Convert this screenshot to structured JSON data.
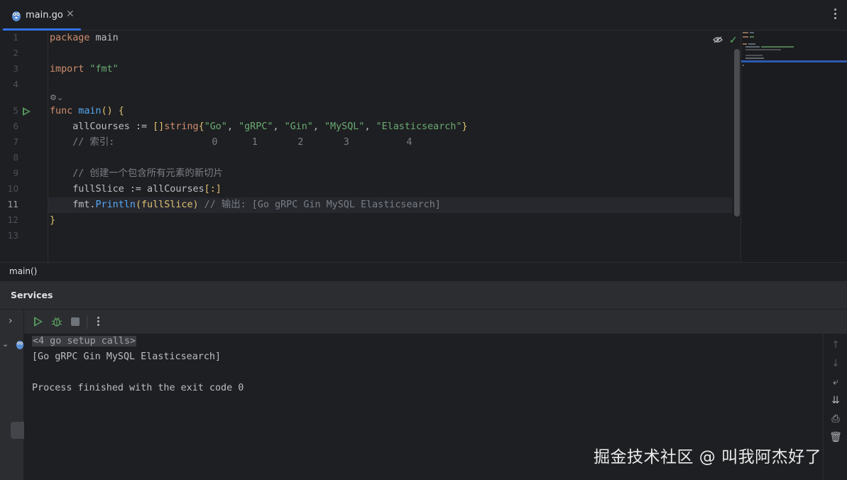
{
  "tab": {
    "file_name": "main.go",
    "close_glyph": "✕",
    "icon": "gopher-icon"
  },
  "editor": {
    "line_numbers": [
      "1",
      "2",
      "3",
      "4",
      "5",
      "6",
      "7",
      "8",
      "9",
      "10",
      "11",
      "12",
      "13"
    ],
    "current_line": "11",
    "lines": {
      "l1_kw": "package",
      "l1_name": " main",
      "l3_kw": "import",
      "l3_str": " \"fmt\"",
      "l5_kw": "func",
      "l5_fn": " main",
      "l5_rest": "() {",
      "l6_var": "    allCourses := ",
      "l6_br": "[]",
      "l6_type": "string",
      "l6_open": "{",
      "l6_s1": "\"Go\"",
      "l6_c1": ", ",
      "l6_s2": "\"gRPC\"",
      "l6_c2": ", ",
      "l6_s3": "\"Gin\"",
      "l6_c3": ", ",
      "l6_s4": "\"MySQL\"",
      "l6_c4": ", ",
      "l6_s5": "\"Elasticsearch\"",
      "l6_close": "}",
      "l7_cmt": "    // 索引:                 0      1       2       3          4",
      "l9_cmt": "    // 创建一个包含所有元素的新切片",
      "l10_code": "    fullSlice := allCourses",
      "l10_br": "[:]",
      "l11_pkg": "    fmt.",
      "l11_fn": "Println",
      "l11_args": "(fullSlice)",
      "l11_cmt": " // 输出: [Go gRPC Gin MySQL Elasticsearch]",
      "l12": "}"
    },
    "inlay_hint": "⚙⌄",
    "accent": "#3574f0"
  },
  "breadcrumb": {
    "label": "main()"
  },
  "services": {
    "title": "Services",
    "console_lines": {
      "fold": "<4 go setup calls>",
      "output": "[Go gRPC Gin MySQL Elasticsearch]",
      "finished": "Process finished with the exit code 0"
    },
    "toolbar_icons": [
      "expand-icon",
      "run-icon",
      "debug-icon",
      "stop-icon",
      "more-icon"
    ],
    "side_icons": {
      "up": "↑",
      "down": "↓",
      "wrap": "⤶",
      "scroll_end": "⇊",
      "print": "⎙",
      "trash": "🗑"
    }
  },
  "watermark": "掘金技术社区 @ 叫我阿杰好了",
  "colors": {
    "run_green": "#57965c",
    "check_green": "#5fb865",
    "background": "#1e1f22"
  }
}
